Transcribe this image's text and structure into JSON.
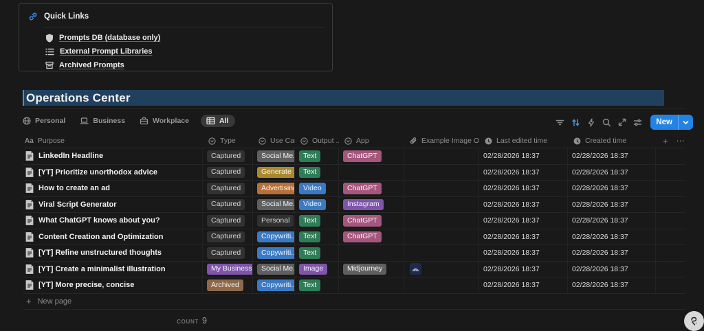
{
  "quick_links": {
    "title": "Quick Links",
    "items": [
      {
        "icon": "shield-icon",
        "label": "Prompts DB (database only)"
      },
      {
        "icon": "bulleted-list-icon",
        "label": "External Prompt Libraries"
      },
      {
        "icon": "archive-icon",
        "label": "Archived Prompts"
      }
    ]
  },
  "page_title": "Operations Center",
  "view_tabs": [
    {
      "icon": "globe-icon",
      "label": "Personal",
      "active": false
    },
    {
      "icon": "laptop-icon",
      "label": "Business",
      "active": false
    },
    {
      "icon": "briefcase-icon",
      "label": "Workplace",
      "active": false
    },
    {
      "icon": "table-icon",
      "label": "All",
      "active": true
    }
  ],
  "toolbar": {
    "icons": [
      "filter-icon",
      "sort-icon",
      "lightning-icon",
      "search-icon",
      "expand-icon",
      "settings-icon"
    ],
    "new_button": {
      "label": "New"
    }
  },
  "table": {
    "columns": [
      {
        "icon_glyph": "Aa",
        "icon": "text-property-icon",
        "label": "Purpose"
      },
      {
        "icon": "select-property-icon",
        "label": "Type"
      },
      {
        "icon": "select-property-icon",
        "label": "Use Case"
      },
      {
        "icon": "select-property-icon",
        "label": "Output ..."
      },
      {
        "icon": "select-property-icon",
        "label": "App"
      },
      {
        "icon": "attachment-property-icon",
        "label": "Example Image Outp..."
      },
      {
        "icon": "clock-icon",
        "label": "Last edited time"
      },
      {
        "icon": "clock-icon",
        "label": "Created time"
      }
    ],
    "add_column_glyph": "+",
    "more_glyph": "⋯",
    "rows": [
      {
        "purpose": "LinkedIn Headline",
        "type": {
          "label": "Captured",
          "color": "default"
        },
        "use_case": {
          "label": "Social Me...",
          "color": "gray"
        },
        "output": {
          "label": "Text",
          "color": "green"
        },
        "app": {
          "label": "ChatGPT",
          "color": "pink"
        },
        "last_edited": "02/28/2026 18:37",
        "created": "02/28/2026 18:37"
      },
      {
        "purpose": "[YT] Prioritize unorthodox advice",
        "type": {
          "label": "Captured",
          "color": "default"
        },
        "use_case": {
          "label": "Generate ...",
          "color": "yellow"
        },
        "output": {
          "label": "Text",
          "color": "green"
        },
        "app": null,
        "last_edited": "02/28/2026 18:37",
        "created": "02/28/2026 18:37"
      },
      {
        "purpose": "How to create an ad",
        "type": {
          "label": "Captured",
          "color": "default"
        },
        "use_case": {
          "label": "Advertising",
          "color": "orange"
        },
        "output": {
          "label": "Video",
          "color": "blue"
        },
        "app": {
          "label": "ChatGPT",
          "color": "pink"
        },
        "last_edited": "02/28/2026 18:37",
        "created": "02/28/2026 18:37"
      },
      {
        "purpose": "Viral Script Generator",
        "type": {
          "label": "Captured",
          "color": "default"
        },
        "use_case": {
          "label": "Social Me...",
          "color": "gray"
        },
        "output": {
          "label": "Video",
          "color": "blue"
        },
        "app": {
          "label": "Instagram",
          "color": "purple"
        },
        "last_edited": "02/28/2026 18:37",
        "created": "02/28/2026 18:37"
      },
      {
        "purpose": "What ChatGPT knows about you?",
        "type": {
          "label": "Captured",
          "color": "default"
        },
        "use_case": {
          "label": "Personal",
          "color": "default"
        },
        "output": {
          "label": "Text",
          "color": "green"
        },
        "app": {
          "label": "ChatGPT",
          "color": "pink"
        },
        "last_edited": "02/28/2026 18:37",
        "created": "02/28/2026 18:37"
      },
      {
        "purpose": "Content Creation and Optimization",
        "type": {
          "label": "Captured",
          "color": "default"
        },
        "use_case": {
          "label": "Copywriti...",
          "color": "blue"
        },
        "output": {
          "label": "Text",
          "color": "green"
        },
        "app": {
          "label": "ChatGPT",
          "color": "pink"
        },
        "last_edited": "02/28/2026 18:37",
        "created": "02/28/2026 18:37"
      },
      {
        "purpose": "[YT] Refine unstructured thoughts",
        "type": {
          "label": "Captured",
          "color": "default"
        },
        "use_case": {
          "label": "Copywriti...",
          "color": "blue"
        },
        "output": {
          "label": "Text",
          "color": "green"
        },
        "app": null,
        "last_edited": "02/28/2026 18:37",
        "created": "02/28/2026 18:37"
      },
      {
        "purpose": "[YT] Create a minimalist illustration",
        "type": {
          "label": "My Business",
          "color": "purple"
        },
        "use_case": {
          "label": "Social Me...",
          "color": "gray"
        },
        "output": {
          "label": "Image",
          "color": "purple"
        },
        "app": {
          "label": "Midjourney",
          "color": "gray"
        },
        "example_image": "thumbnail",
        "last_edited": "02/28/2026 18:37",
        "created": "02/28/2026 18:37"
      },
      {
        "purpose": "[YT] More precise, concise",
        "type": {
          "label": "Archived",
          "color": "brown"
        },
        "use_case": {
          "label": "Copywriti...",
          "color": "blue"
        },
        "output": {
          "label": "Text",
          "color": "green"
        },
        "app": null,
        "last_edited": "02/28/2026 18:37",
        "created": "02/28/2026 18:37"
      }
    ],
    "new_page": {
      "plus_glyph": "+",
      "label": "New page"
    },
    "footer": {
      "count_label": "COUNT",
      "count_value": "9"
    }
  },
  "colors": {
    "background": "#191919",
    "accent_blue": "#2383e2",
    "title_selection": "#21405e",
    "tag_palette": {
      "default": "#313131",
      "gray": "#5f5f5f",
      "green": "#2f7d58",
      "pink": "#a4567c",
      "yellow": "#a9882f",
      "orange": "#b86f39",
      "blue": "#3b79c2",
      "purple": "#7e55a8",
      "brown": "#8e684a"
    }
  }
}
